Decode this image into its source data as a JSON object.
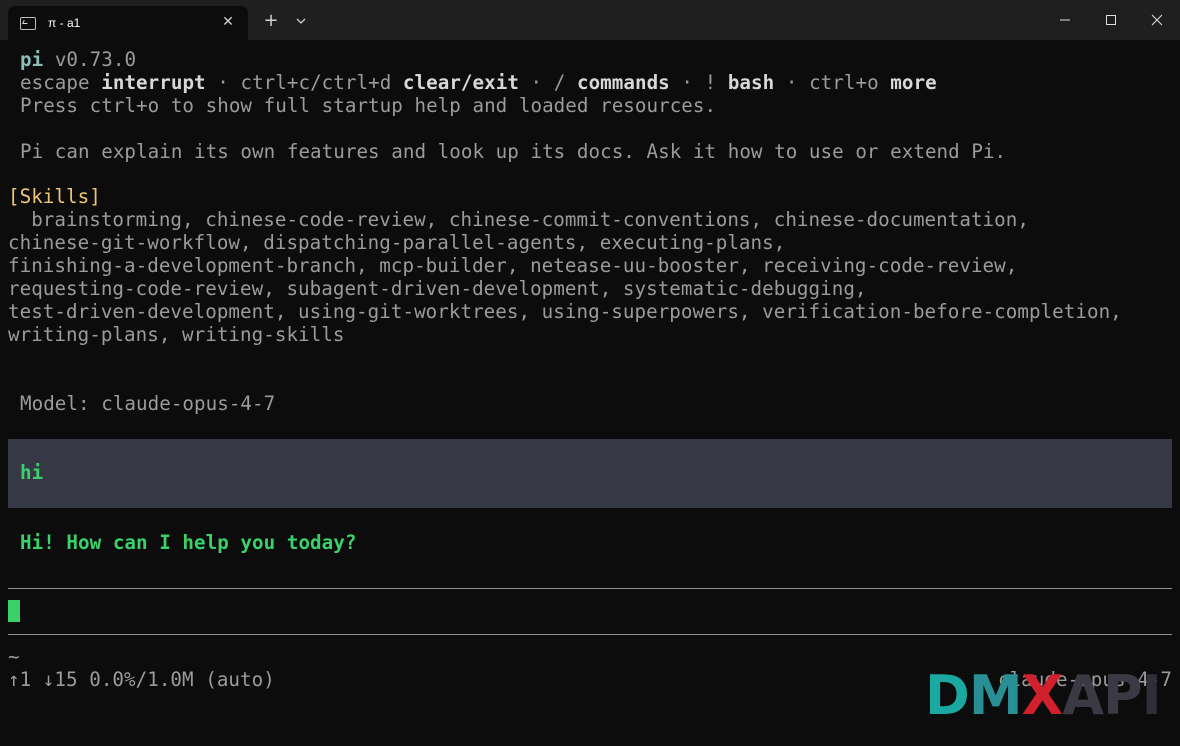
{
  "window": {
    "tab_title": "π - a1",
    "tab_icon": "terminal-icon",
    "new_tab_icon": "+",
    "controls": [
      "minimize-icon",
      "maximize-icon",
      "close-icon"
    ]
  },
  "terminal": {
    "version_line": {
      "app": "pi",
      "version": "v0.73.0"
    },
    "shortcuts": [
      {
        "key": "escape",
        "action": "interrupt"
      },
      {
        "key": "ctrl+c/ctrl+d",
        "action": "clear/exit"
      },
      {
        "key": "/",
        "action": "commands"
      },
      {
        "key": "!",
        "action": "bash"
      },
      {
        "key": "ctrl+o",
        "action": "more"
      }
    ],
    "separator": " · ",
    "help_line": "Press ctrl+o to show full startup help and loaded resources.",
    "intro_line": "Pi can explain its own features and look up its docs. Ask it how to use or extend Pi.",
    "skills_header": "[Skills]",
    "skills_lines": [
      "  brainstorming, chinese-code-review, chinese-commit-conventions, chinese-documentation,",
      "chinese-git-workflow, dispatching-parallel-agents, executing-plans,",
      "finishing-a-development-branch, mcp-builder, netease-uu-booster, receiving-code-review,",
      "requesting-code-review, subagent-driven-development, systematic-debugging,",
      "test-driven-development, using-git-worktrees, using-superpowers, verification-before-completion,",
      "writing-plans, writing-skills"
    ],
    "model_line": "Model: claude-opus-4-7",
    "user_message": "hi",
    "assistant_message": "Hi! How can I help you today?",
    "status": {
      "cwd": "~",
      "stats": "↑1 ↓15 0.0%/1.0M (auto)",
      "model": "claude-opus-4-7"
    }
  },
  "watermark": {
    "letters": [
      "D",
      "M",
      "X",
      "A",
      "P",
      "I"
    ],
    "colors": [
      "#1aa9a0",
      "#2a8f94",
      "#6b3f7a",
      "#d11f2b",
      "#3a3a44",
      "#2f2f38"
    ]
  },
  "colors": {
    "background": "#0c0c0c",
    "user_message_bg": "#373845",
    "accent_green": "#3ad16a",
    "skills_yellow": "#f0c674"
  }
}
